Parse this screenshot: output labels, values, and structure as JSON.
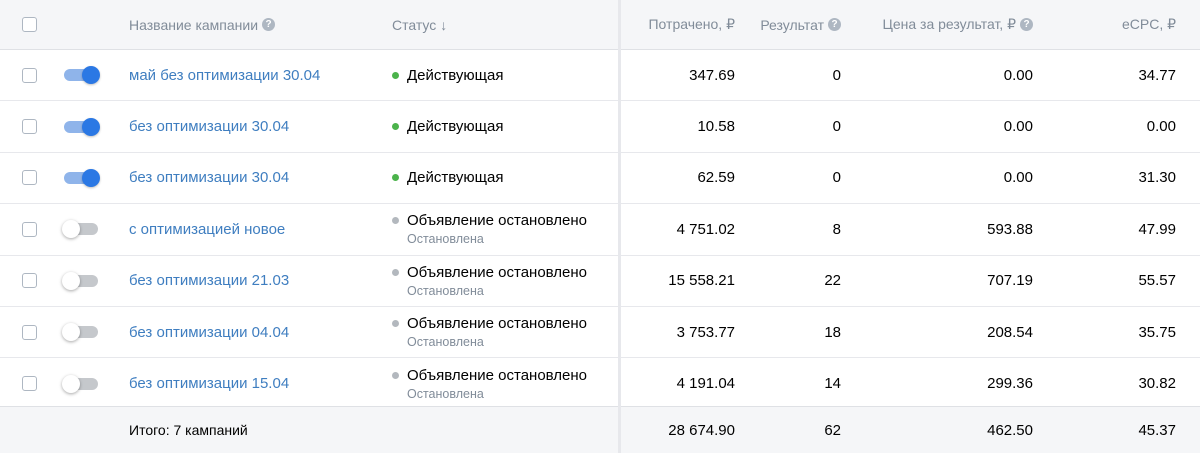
{
  "header": {
    "name": "Название кампании",
    "status": "Статус",
    "status_sort_arrow": "↓",
    "spent": "Потрачено, ₽",
    "result": "Результат",
    "price": "Цена за результат, ₽",
    "ecpc": "eCPC, ₽",
    "help_icon": "?"
  },
  "colors": {
    "active": "#4bb34b",
    "stopped": "#b3b8be",
    "link": "#3f7ec0",
    "toggle_on": "#2b78e4"
  },
  "rows": [
    {
      "toggle_on": true,
      "name": "май без оптимизации 30.04",
      "status": "Действующая",
      "status_color": "#4bb34b",
      "sub": "",
      "spent": "347.69",
      "result": "0",
      "price": "0.00",
      "ecpc": "34.77"
    },
    {
      "toggle_on": true,
      "name": "без оптимизации 30.04",
      "status": "Действующая",
      "status_color": "#4bb34b",
      "sub": "",
      "spent": "10.58",
      "result": "0",
      "price": "0.00",
      "ecpc": "0.00"
    },
    {
      "toggle_on": true,
      "name": "без оптимизации 30.04",
      "status": "Действующая",
      "status_color": "#4bb34b",
      "sub": "",
      "spent": "62.59",
      "result": "0",
      "price": "0.00",
      "ecpc": "31.30"
    },
    {
      "toggle_on": false,
      "name": "с оптимизацией новое",
      "status": "Объявление остановлено",
      "status_color": "#b3b8be",
      "sub": "Остановлена",
      "spent": "4 751.02",
      "result": "8",
      "price": "593.88",
      "ecpc": "47.99"
    },
    {
      "toggle_on": false,
      "name": "без оптимизации 21.03",
      "status": "Объявление остановлено",
      "status_color": "#b3b8be",
      "sub": "Остановлена",
      "spent": "15 558.21",
      "result": "22",
      "price": "707.19",
      "ecpc": "55.57"
    },
    {
      "toggle_on": false,
      "name": "без оптимизации 04.04",
      "status": "Объявление остановлено",
      "status_color": "#b3b8be",
      "sub": "Остановлена",
      "spent": "3 753.77",
      "result": "18",
      "price": "208.54",
      "ecpc": "35.75"
    },
    {
      "toggle_on": false,
      "name": "без оптимизации 15.04",
      "status": "Объявление остановлено",
      "status_color": "#b3b8be",
      "sub": "Остановлена",
      "spent": "4 191.04",
      "result": "14",
      "price": "299.36",
      "ecpc": "30.82"
    }
  ],
  "footer": {
    "label": "Итого: 7 кампаний",
    "spent": "28 674.90",
    "result": "62",
    "price": "462.50",
    "ecpc": "45.37"
  }
}
